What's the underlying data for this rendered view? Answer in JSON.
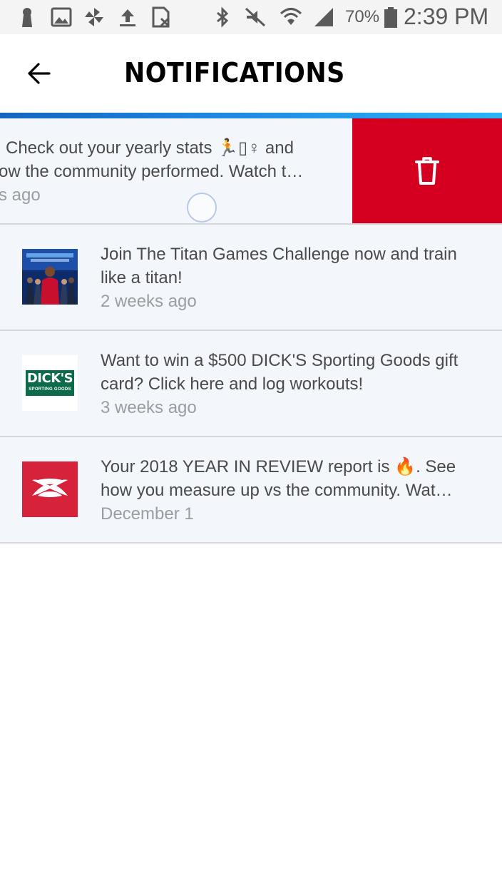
{
  "status_bar": {
    "battery_percent": "70%",
    "time": "2:39 PM",
    "icons": [
      "keyhole-icon",
      "image-icon",
      "pinwheel-icon",
      "upload-icon",
      "sim-icon",
      "bluetooth-icon",
      "mute-icon",
      "wifi-icon",
      "signal-icon",
      "battery-icon"
    ]
  },
  "header": {
    "title": "NOTIFICATIONS",
    "back_icon": "arrow-left-icon"
  },
  "notifications": [
    {
      "message": "Check out your yearly stats 🏃‍♀️ and how the community performed. Watch t…",
      "message_visible_line1": "Check out your yearly stats 🏃‍▯♀ and",
      "message_visible_line2": "ow the community performed. Watch t…",
      "time_visible": "s ago",
      "swiped": true,
      "action_icon": "trash-icon"
    },
    {
      "message": "Join The Titan Games Challenge now and train like a titan!",
      "time": "2 weeks ago",
      "thumb": "titan-games-thumbnail"
    },
    {
      "message": "Want to win a $500 DICK'S Sporting Goods gift card? Click here and log workouts!",
      "time": "3 weeks ago",
      "thumb": "dicks-logo",
      "logo_text_1": "DICK'S",
      "logo_text_2": "SPORTING GOODS"
    },
    {
      "message": "Your 2018 YEAR IN REVIEW report is 🔥. See how you measure up vs the community. Wat…",
      "time": "December 1",
      "thumb": "under-armour-logo"
    }
  ],
  "colors": {
    "accent_gradient_start": "#1565c0",
    "accent_gradient_end": "#29b6f6",
    "delete_red": "#d50020",
    "row_bg": "#f3f6fa"
  }
}
